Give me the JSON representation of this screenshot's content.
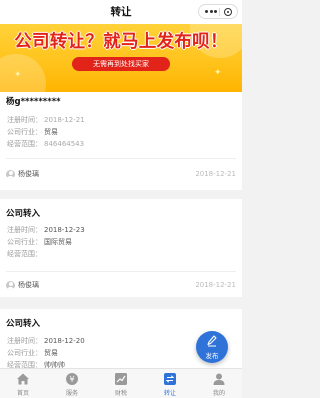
{
  "nav": {
    "title": "转让"
  },
  "banner": {
    "headline": "公司转让？就马上发布呗！",
    "subtitle": "无需再到处找买家"
  },
  "listings": [
    {
      "company": "杨g*********",
      "fields": [
        {
          "label": "注册时间：",
          "value": "2018-12-21"
        },
        {
          "label": "公司行业：",
          "value": "贸易"
        },
        {
          "label": "经营范围：",
          "value": "846464543"
        }
      ],
      "contact": "杨俊璃",
      "date": "2018-12-21"
    },
    {
      "company": "公司转入",
      "fields": [
        {
          "label": "注册时间：",
          "value": "2018-12-23"
        },
        {
          "label": "公司行业：",
          "value": "国际贸易"
        },
        {
          "label": "经营范围：",
          "value": ""
        }
      ],
      "contact": "杨俊璃",
      "date": "2018-12-21"
    },
    {
      "company": "公司转入",
      "fields": [
        {
          "label": "注册时间：",
          "value": "2018-12-20"
        },
        {
          "label": "公司行业：",
          "value": "贸易"
        },
        {
          "label": "经营范围：",
          "value": "帅帅帅"
        }
      ]
    }
  ],
  "fab": {
    "label": "发布",
    "icon": "pencil-icon"
  },
  "tabbar": {
    "tabs": [
      {
        "label": "首页",
        "icon": "home-icon"
      },
      {
        "label": "服务",
        "icon": "service-icon"
      },
      {
        "label": "财税",
        "icon": "trend-chart-icon"
      },
      {
        "label": "转让",
        "icon": "transfer-icon",
        "active": true
      },
      {
        "label": "我的",
        "icon": "user-icon"
      }
    ]
  },
  "colors": {
    "banner_yellow": "#ffc21a",
    "banner_red": "#e2231a",
    "accent_blue": "#2f73d9"
  }
}
